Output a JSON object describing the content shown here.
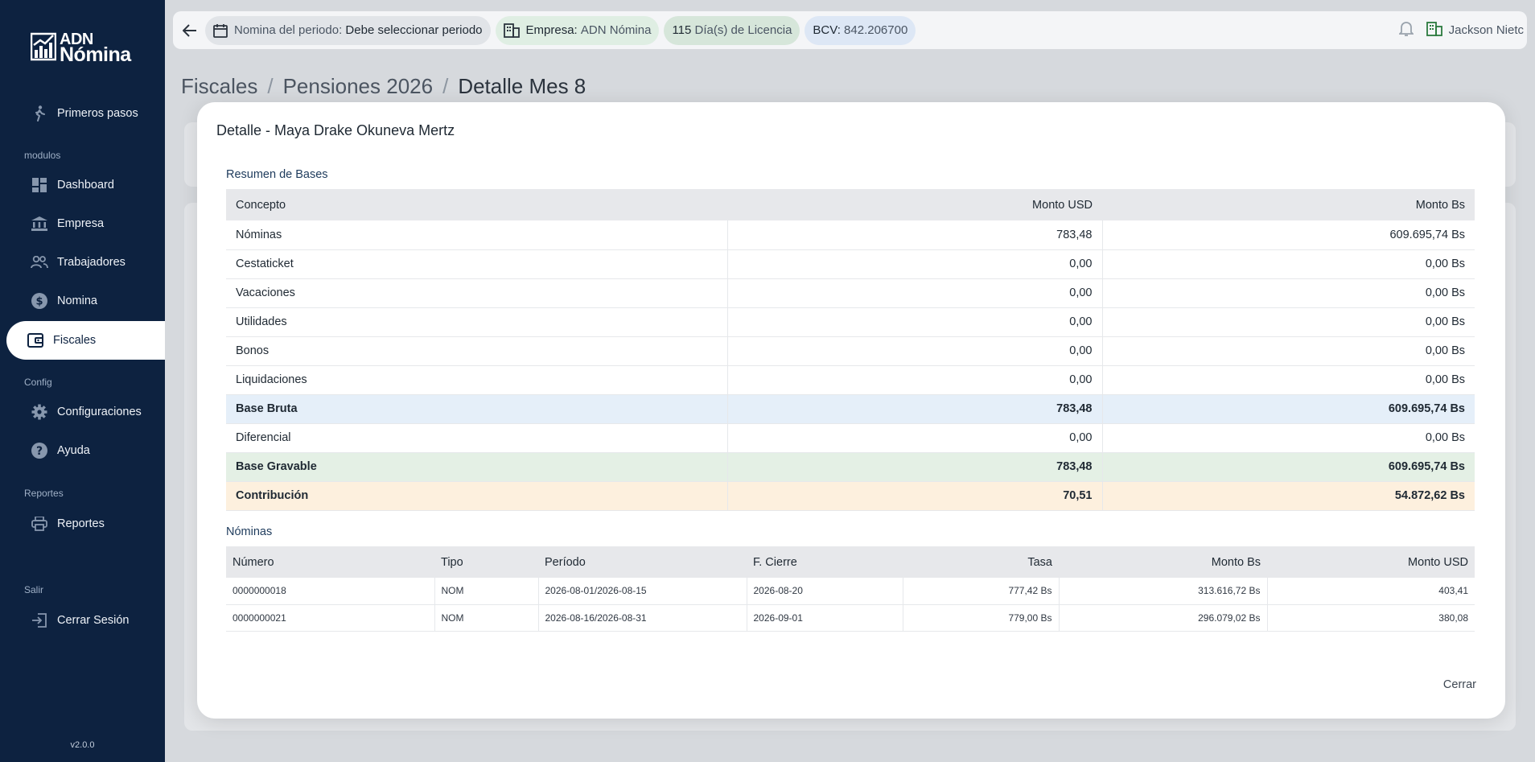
{
  "brand": {
    "line1": "ADN",
    "line2": "Nómina"
  },
  "sidebar": {
    "items": [
      {
        "label": "Primeros pasos",
        "icon": "walking-person-icon"
      },
      {
        "label": "Dashboard",
        "icon": "dashboard-icon"
      },
      {
        "label": "Empresa",
        "icon": "bank-icon"
      },
      {
        "label": "Trabajadores",
        "icon": "people-icon"
      },
      {
        "label": "Nomina",
        "icon": "dollar-circle-icon"
      },
      {
        "label": "Fiscales",
        "icon": "wallet-icon",
        "active": true
      },
      {
        "label": "Configuraciones",
        "icon": "gear-icon"
      },
      {
        "label": "Ayuda",
        "icon": "help-icon"
      },
      {
        "label": "Reportes",
        "icon": "printer-icon"
      },
      {
        "label": "Cerrar Sesión",
        "icon": "logout-icon"
      }
    ],
    "sections": {
      "modulos": "modulos",
      "config": "Config",
      "reportes": "Reportes",
      "salir": "Salir"
    },
    "version": "v2.0.0"
  },
  "topbar": {
    "period_label": "Nomina del periodo:",
    "period_value": "Debe seleccionar periodo",
    "company_label": "Empresa:",
    "company_value": "ADN Nómina",
    "license_count": "115",
    "license_label": "Día(s) de Licencia",
    "bcv_label": "BCV:",
    "bcv_value": "842.206700",
    "user_name": "Jackson Nietc"
  },
  "breadcrumb": {
    "items": [
      "Fiscales",
      "Pensiones 2026",
      "Detalle Mes 8"
    ],
    "separator": "/"
  },
  "modal": {
    "title": "Detalle - Maya Drake Okuneva Mertz",
    "bases_title": "Resumen de Bases",
    "bases_headers": [
      "Concepto",
      "Monto USD",
      "Monto Bs"
    ],
    "bases_rows": [
      {
        "concepto": "Nóminas",
        "usd": "783,48",
        "bs": "609.695,74 Bs"
      },
      {
        "concepto": "Cestaticket",
        "usd": "0,00",
        "bs": "0,00 Bs"
      },
      {
        "concepto": "Vacaciones",
        "usd": "0,00",
        "bs": "0,00 Bs"
      },
      {
        "concepto": "Utilidades",
        "usd": "0,00",
        "bs": "0,00 Bs"
      },
      {
        "concepto": "Bonos",
        "usd": "0,00",
        "bs": "0,00 Bs"
      },
      {
        "concepto": "Liquidaciones",
        "usd": "0,00",
        "bs": "0,00 Bs"
      },
      {
        "concepto": "Base Bruta",
        "usd": "783,48",
        "bs": "609.695,74 Bs"
      },
      {
        "concepto": "Diferencial",
        "usd": "0,00",
        "bs": "0,00 Bs"
      },
      {
        "concepto": "Base Gravable",
        "usd": "783,48",
        "bs": "609.695,74 Bs"
      },
      {
        "concepto": "Contribución",
        "usd": "70,51",
        "bs": "54.872,62 Bs"
      }
    ],
    "nominas_title": "Nóminas",
    "nominas_headers": [
      "Número",
      "Tipo",
      "Período",
      "F. Cierre",
      "Tasa",
      "Monto Bs",
      "Monto USD"
    ],
    "nominas_rows": [
      {
        "numero": "0000000018",
        "tipo": "NOM",
        "periodo": "2026-08-01/2026-08-15",
        "cierre": "2026-08-20",
        "tasa": "777,42 Bs",
        "monto_bs": "313.616,72 Bs",
        "monto_usd": "403,41"
      },
      {
        "numero": "0000000021",
        "tipo": "NOM",
        "periodo": "2026-08-16/2026-08-31",
        "cierre": "2026-09-01",
        "tasa": "779,00 Bs",
        "monto_bs": "296.079,02 Bs",
        "monto_usd": "380,08"
      }
    ],
    "close_label": "Cerrar"
  },
  "colors": {
    "sidebar": "#0d2240",
    "accent_blue": "#1e3b5c",
    "row_bruta": "#e5eff9",
    "row_gravable": "#e4f0e5",
    "row_contrib": "#fdf0de"
  }
}
